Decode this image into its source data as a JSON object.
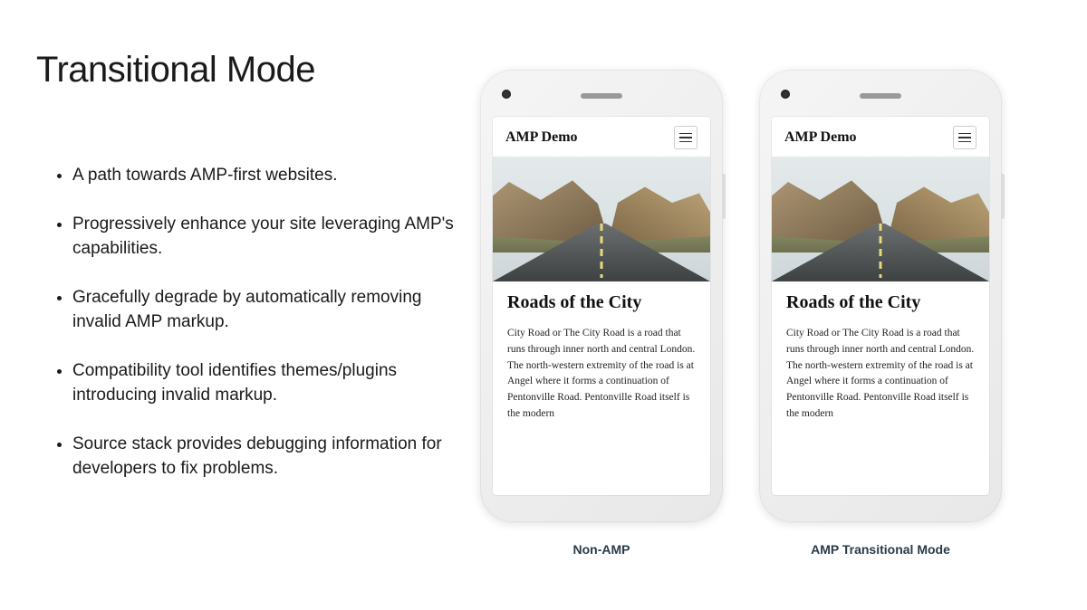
{
  "title": "Transitional Mode",
  "bullets": [
    "A path towards AMP-first websites.",
    "Progressively enhance your site leveraging AMP's capabilities.",
    "Gracefully degrade by automatically removing invalid AMP markup.",
    "Compatibility tool identifies themes/plugins introducing invalid markup.",
    "Source stack provides debugging information for developers to fix problems."
  ],
  "phones": [
    {
      "app_title": "AMP Demo",
      "post_title": "Roads of the City",
      "post_body": "City Road or The City Road is a road that runs through inner north and central London. The north-western extremity of the road is at Angel where it forms a continuation of Pentonville Road. Pentonville Road itself is the modern",
      "caption": "Non-AMP"
    },
    {
      "app_title": "AMP Demo",
      "post_title": "Roads of the City",
      "post_body": "City Road or The City Road is a road that runs through inner north and central London. The north-western extremity of the road is at Angel where it forms a continuation of Pentonville Road. Pentonville Road itself is the modern",
      "caption": "AMP Transitional  Mode"
    }
  ]
}
